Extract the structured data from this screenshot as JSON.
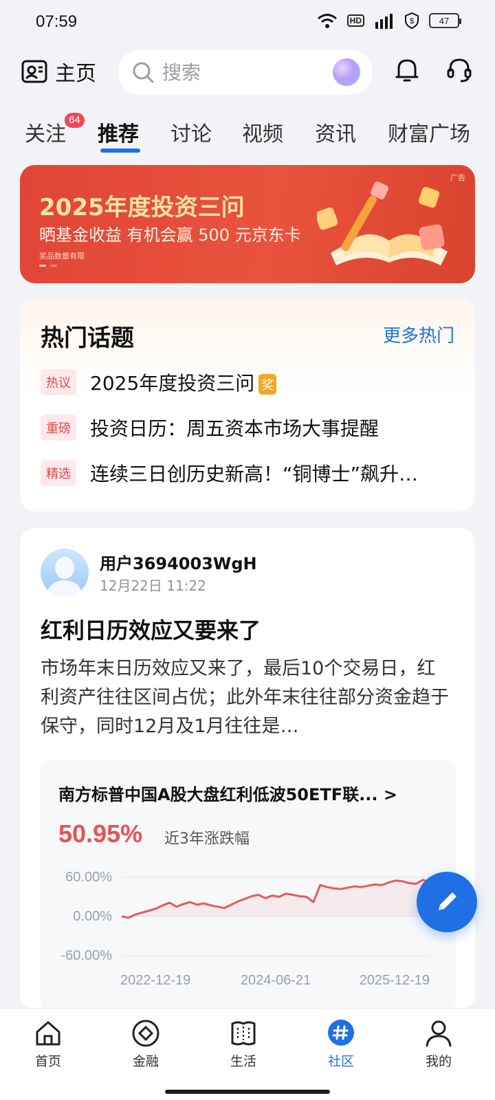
{
  "status": {
    "time": "07:59",
    "battery": "47",
    "hd": "HD",
    "network": "5G"
  },
  "header": {
    "home_label": "主页",
    "search_placeholder": "搜索"
  },
  "tabs": [
    {
      "label": "关注",
      "badge": "64"
    },
    {
      "label": "推荐",
      "active": true
    },
    {
      "label": "讨论"
    },
    {
      "label": "视频"
    },
    {
      "label": "资讯"
    },
    {
      "label": "财富广场"
    }
  ],
  "banner": {
    "title": "2025年度投资三问",
    "subtitle": "晒基金收益 有机会赢 500 元京东卡",
    "note": "奖品数量有限",
    "ad_label": "广告"
  },
  "hot_topics": {
    "title": "热门话题",
    "more": "更多热门",
    "items": [
      {
        "tag": "热议",
        "text": "2025年度投资三问",
        "award": "奖"
      },
      {
        "tag": "重磅",
        "text": "投资日历：周五资本市场大事提醒"
      },
      {
        "tag": "精选",
        "text": "连续三日创历史新高！“铜博士”飙升…"
      }
    ]
  },
  "post": {
    "user": "用户3694003WgH",
    "time": "12月22日 11:22",
    "title": "红利日历效应又要来了",
    "body": "市场年末日历效应又来了，最后10个交易日，红利资产往往区间占优；此外年末往往部分资金趋于保守，同时12月及1月往往是…",
    "fund": {
      "name": "南方标普中国A股大盘红利低波50ETF联... >",
      "return": "50.95%",
      "return_label": "近3年涨跌幅"
    }
  },
  "chart_data": {
    "type": "line",
    "x_ticks": [
      "2022-12-19",
      "2024-06-21",
      "2025-12-19"
    ],
    "y_ticks": [
      "60.00%",
      "0.00%",
      "-60.00%"
    ],
    "ylim": [
      -60,
      60
    ],
    "series": [
      {
        "values": [
          0,
          -2,
          3,
          6,
          9,
          12,
          17,
          21,
          15,
          19,
          22,
          18,
          20,
          17,
          15,
          13,
          18,
          23,
          27,
          31,
          33,
          28,
          32,
          30,
          35,
          33,
          31,
          30,
          22,
          48,
          45,
          43,
          42,
          44,
          46,
          45,
          47,
          49,
          48,
          52,
          55,
          54,
          51,
          50,
          56,
          53
        ]
      }
    ],
    "line_color": "#e85a5a",
    "grid": true
  },
  "bottom_nav": [
    {
      "label": "首页",
      "icon": "home-icon"
    },
    {
      "label": "金融",
      "icon": "finance-icon"
    },
    {
      "label": "生活",
      "icon": "life-ticket-icon"
    },
    {
      "label": "社区",
      "icon": "community-hash-icon",
      "active": true
    },
    {
      "label": "我的",
      "icon": "profile-icon"
    }
  ]
}
